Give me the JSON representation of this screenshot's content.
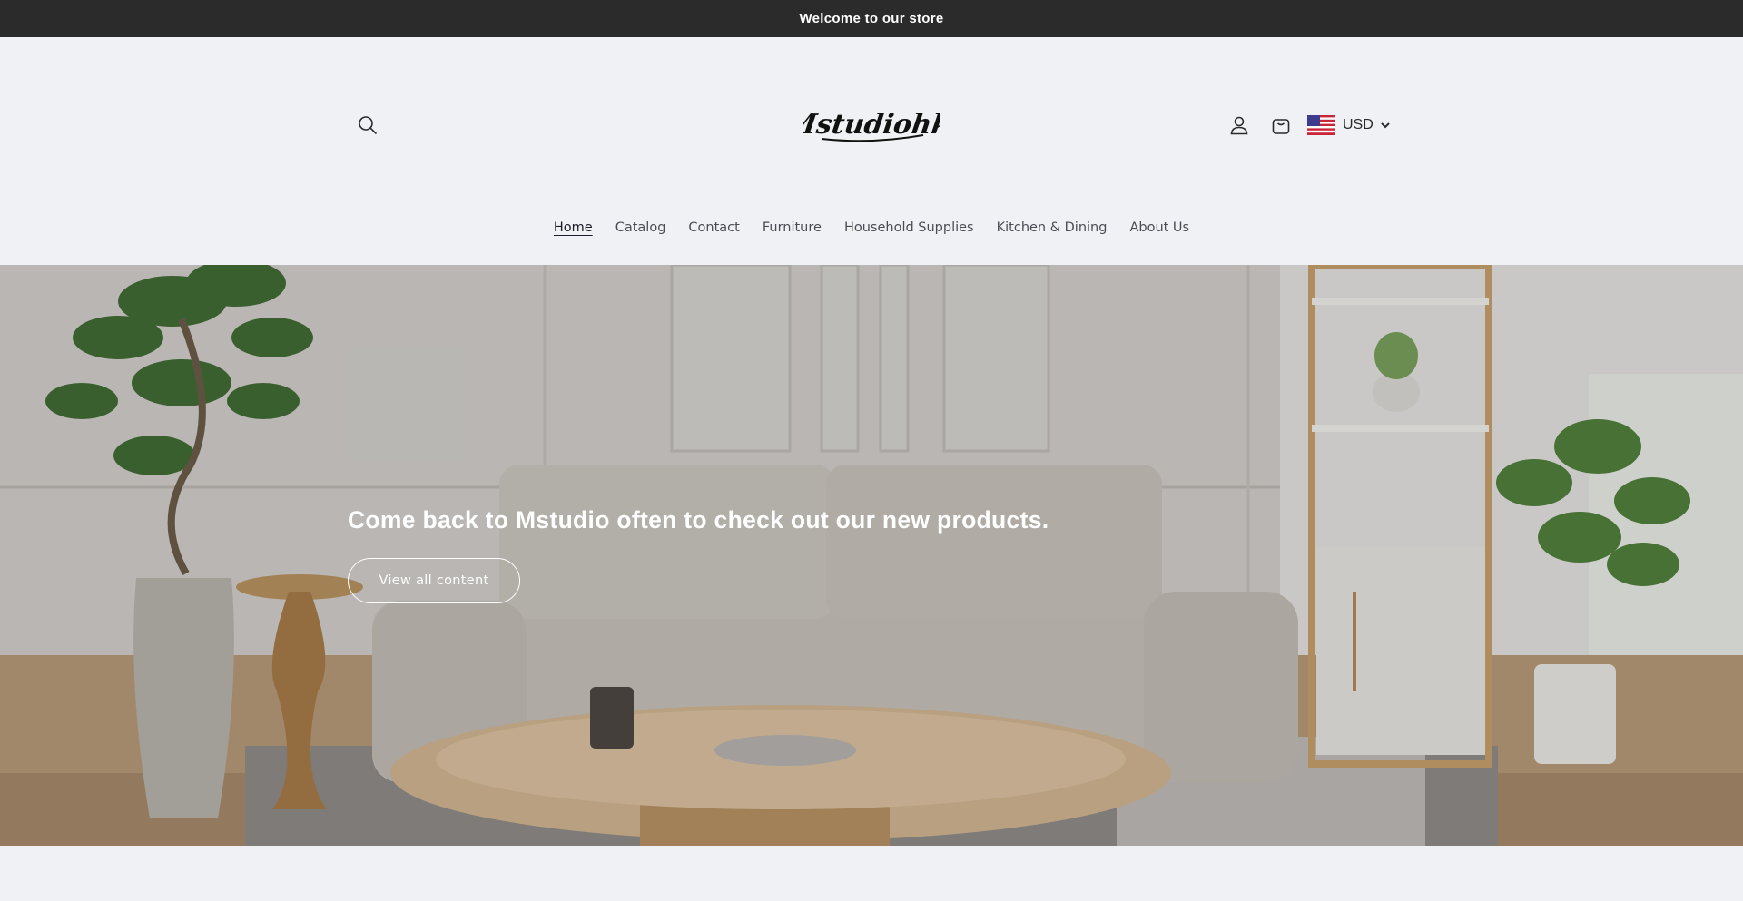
{
  "announcement": {
    "text": "Welcome to our store"
  },
  "header": {
    "logo_text": "Mstudiohk",
    "icons": {
      "search": "search-icon",
      "account": "account-icon",
      "cart": "cart-icon"
    },
    "currency": {
      "code": "USD",
      "flag": "us-flag-icon"
    }
  },
  "nav": {
    "items": [
      {
        "label": "Home",
        "active": true
      },
      {
        "label": "Catalog"
      },
      {
        "label": "Contact"
      },
      {
        "label": "Furniture"
      },
      {
        "label": "Household Supplies"
      },
      {
        "label": "Kitchen & Dining"
      },
      {
        "label": "About Us"
      }
    ]
  },
  "hero": {
    "title": "Come back to Mstudio often to check out our new products.",
    "button_label": "View all content"
  },
  "colors": {
    "announcement_bg": "#2b2b2b",
    "page_bg": "#f0f1f5",
    "nav_text": "#4b4b55"
  }
}
